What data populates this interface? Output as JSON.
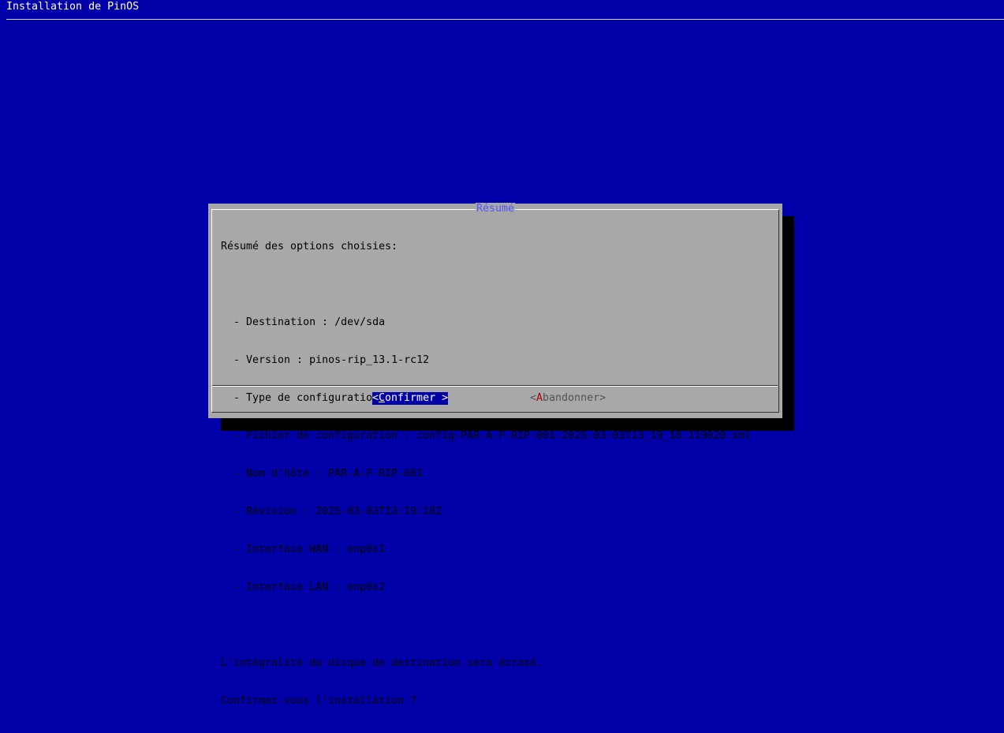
{
  "screen": {
    "backtitle": "Installation de PinOS"
  },
  "dialog": {
    "title": "Résumé",
    "intro": "Résumé des options choisies:",
    "items": [
      "  - Destination : /dev/sda",
      "  - Version : pinos-rip_13.1-rc12",
      "  - Type de configuration : Locale",
      "  - Fichier de configuration : config-PAR-A-F-RIP-001-2025-03-03T13_19_18.119020.xml",
      "  - Nom d'hôte : PAR-A-F-RIP-001",
      "  - Révision : 2025-03-03T13:19:18Z",
      "  - Interface WAN : enp0s1",
      "  - Interface LAN : enp0s2"
    ],
    "warning": "L'intégralité du disque de destination sera écrasé.",
    "question": "Confirmez-vous l'installation ?"
  },
  "buttons": {
    "confirm": {
      "open": "<",
      "hotkey": "C",
      "rest": "onfirmer",
      "close": " >"
    },
    "abort": {
      "open": "<",
      "hotkey": "A",
      "rest": "bandonner",
      "close": ">"
    }
  },
  "colors": {
    "background": "#0000a8",
    "dialog": "#a8a8a8",
    "title": "#5454fc",
    "selected_button": "#0000a8",
    "hotkey": "#a80000"
  }
}
